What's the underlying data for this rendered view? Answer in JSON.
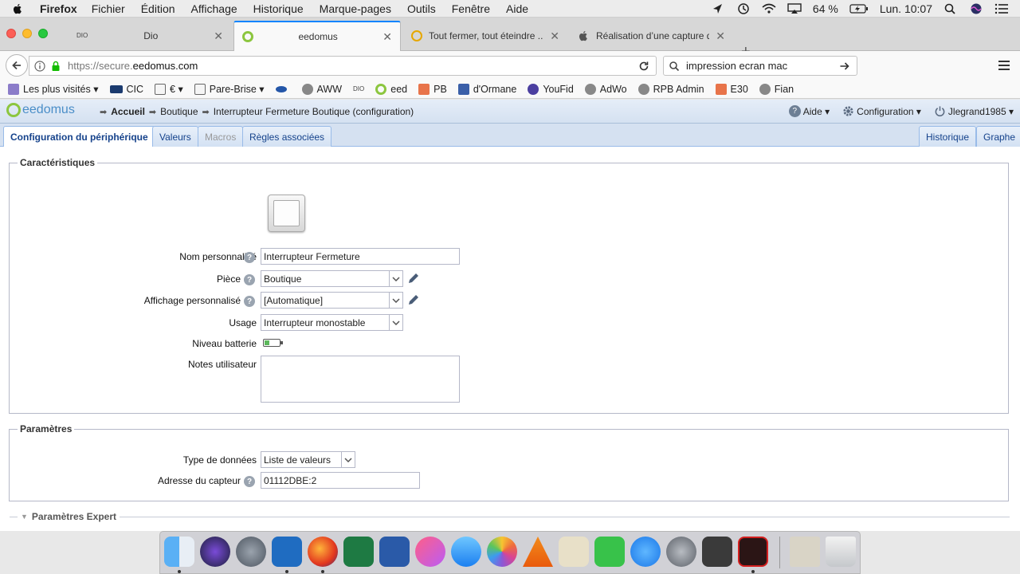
{
  "menubar": {
    "app_name": "Firefox",
    "menus": [
      "Fichier",
      "Édition",
      "Affichage",
      "Historique",
      "Marque-pages",
      "Outils",
      "Fenêtre",
      "Aide"
    ],
    "battery": "64 %",
    "clock": "Lun. 10:07"
  },
  "tabs": [
    {
      "favicon_text": "DIO",
      "title": "Dio"
    },
    {
      "title": "eedomus"
    },
    {
      "title": "Tout fermer, tout éteindre ..."
    },
    {
      "title": "Réalisation d’une capture d..."
    }
  ],
  "nav": {
    "url_scheme": "https://secure.",
    "url_host": "eedomus.com",
    "search_value": "impression ecran mac"
  },
  "bookmarks": [
    "Les plus visités",
    "CIC",
    "€",
    "Pare-Brise",
    "AWW",
    "eed",
    "PB",
    "d'Ormane",
    "YouFid",
    "AdWo",
    "RPB Admin",
    "E30",
    "Fian"
  ],
  "bookmarks_dio": "DIO",
  "app": {
    "logo": "eedomus",
    "breadcrumb": [
      "Accueil",
      "Boutique",
      "Interrupteur Fermeture Boutique (configuration)"
    ],
    "help": "Aide",
    "configuration": "Configuration",
    "user": "Jlegrand1985"
  },
  "page_tabs": {
    "config": "Configuration du périphérique",
    "valeurs": "Valeurs",
    "macros": "Macros",
    "regles": "Règles associées",
    "historique": "Historique",
    "graphe": "Graphe"
  },
  "caracteristiques": {
    "legend": "Caractéristiques",
    "nom_label": "Nom personnalisé",
    "nom_value": "Interrupteur Fermeture",
    "piece_label": "Pièce",
    "piece_value": "Boutique",
    "affichage_label": "Affichage personnalisé",
    "affichage_value": "[Automatique]",
    "usage_label": "Usage",
    "usage_value": "Interrupteur monostable",
    "batterie_label": "Niveau batterie",
    "batterie_level": 0.35,
    "notes_label": "Notes utilisateur",
    "notes_value": ""
  },
  "parametres": {
    "legend": "Paramètres",
    "type_label": "Type de données",
    "type_value": "Liste de valeurs",
    "adresse_label": "Adresse du capteur",
    "adresse_value": "01112DBE:2"
  },
  "expert": {
    "legend": "Paramètres Expert"
  },
  "colors": {
    "accent": "#0a84ff",
    "header_bg": "#d5e1f1",
    "tab_text": "#15428b",
    "logo_ring": "#8cc63f"
  }
}
